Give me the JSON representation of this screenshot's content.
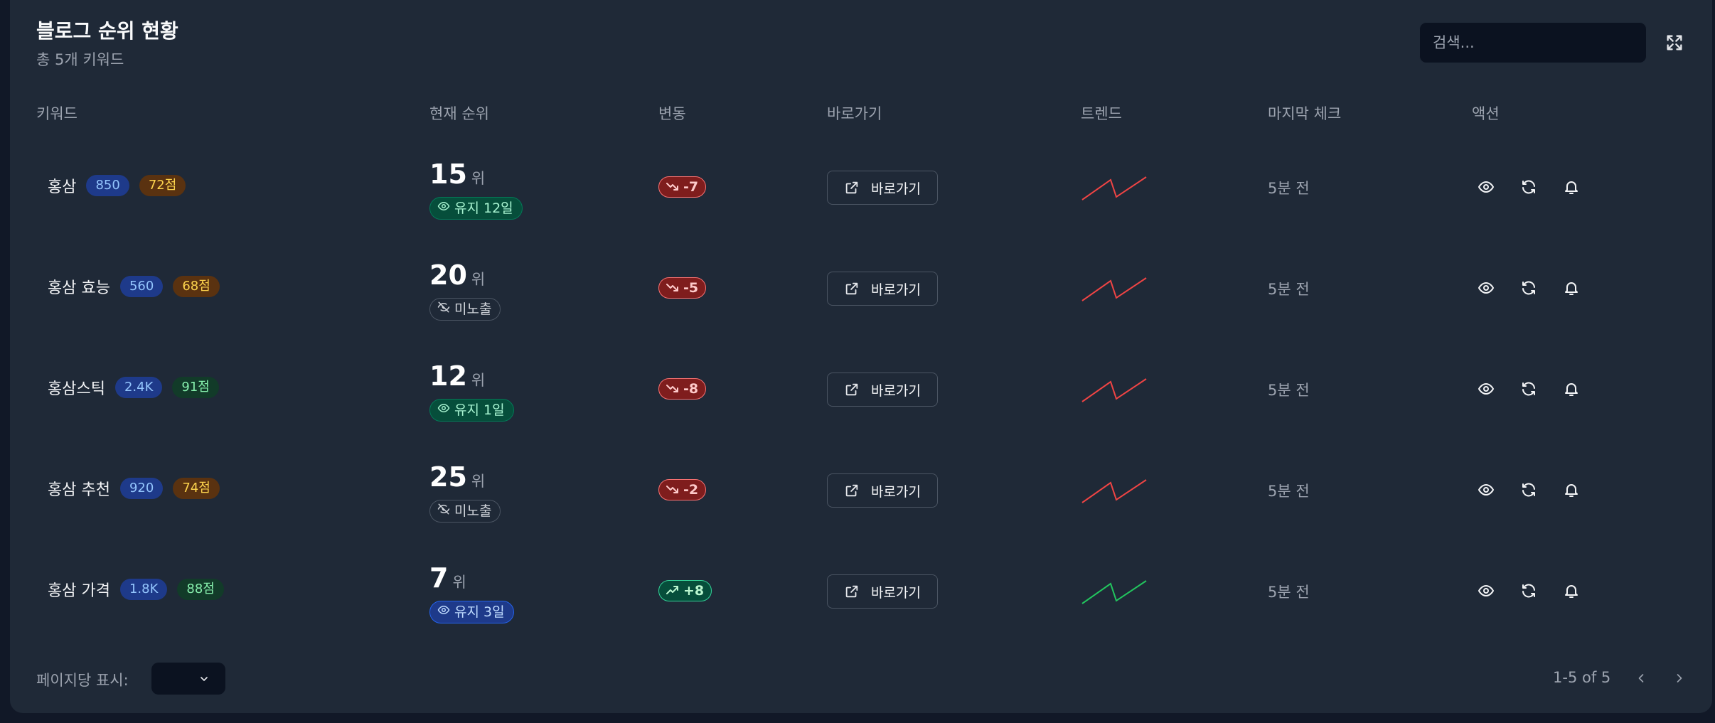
{
  "header": {
    "title": "블로그 순위 현황",
    "subtitle": "총 5개 키워드",
    "search_placeholder": "검색..."
  },
  "columns": [
    "키워드",
    "현재 순위",
    "변동",
    "바로가기",
    "트렌드",
    "마지막 체크",
    "액션"
  ],
  "rows": [
    {
      "keyword": "홍삼",
      "volume": "850",
      "score": "72점",
      "score_tone": "amber",
      "rank": "15",
      "rank_unit": "위",
      "status": "유지 12일",
      "status_type": "keep",
      "change": "-7",
      "change_dir": "down",
      "link_label": "바로가기",
      "trend_color": "#ef4444",
      "last_check": "5분 전"
    },
    {
      "keyword": "홍삼 효능",
      "volume": "560",
      "score": "68점",
      "score_tone": "amber",
      "rank": "20",
      "rank_unit": "위",
      "status": "미노출",
      "status_type": "hidden",
      "change": "-5",
      "change_dir": "down",
      "link_label": "바로가기",
      "trend_color": "#ef4444",
      "last_check": "5분 전"
    },
    {
      "keyword": "홍삼스틱",
      "volume": "2.4K",
      "score": "91점",
      "score_tone": "green",
      "rank": "12",
      "rank_unit": "위",
      "status": "유지 1일",
      "status_type": "keep",
      "change": "-8",
      "change_dir": "down",
      "link_label": "바로가기",
      "trend_color": "#ef4444",
      "last_check": "5분 전"
    },
    {
      "keyword": "홍삼 추천",
      "volume": "920",
      "score": "74점",
      "score_tone": "amber",
      "rank": "25",
      "rank_unit": "위",
      "status": "미노출",
      "status_type": "hidden",
      "change": "-2",
      "change_dir": "down",
      "link_label": "바로가기",
      "trend_color": "#ef4444",
      "last_check": "5분 전"
    },
    {
      "keyword": "홍삼 가격",
      "volume": "1.8K",
      "score": "88점",
      "score_tone": "green",
      "rank": "7",
      "rank_unit": "위",
      "status": "유지 3일",
      "status_type": "keep-blue",
      "change": "+8",
      "change_dir": "up",
      "link_label": "바로가기",
      "trend_color": "#22c55e",
      "last_check": "5분 전"
    }
  ],
  "footer": {
    "per_page_label": "페이지당 표시:",
    "page_info": "1-5 of 5"
  },
  "icons": {
    "expand": "expand-icon",
    "view": "eye-icon",
    "refresh": "refresh-icon",
    "alert": "bell-icon"
  }
}
